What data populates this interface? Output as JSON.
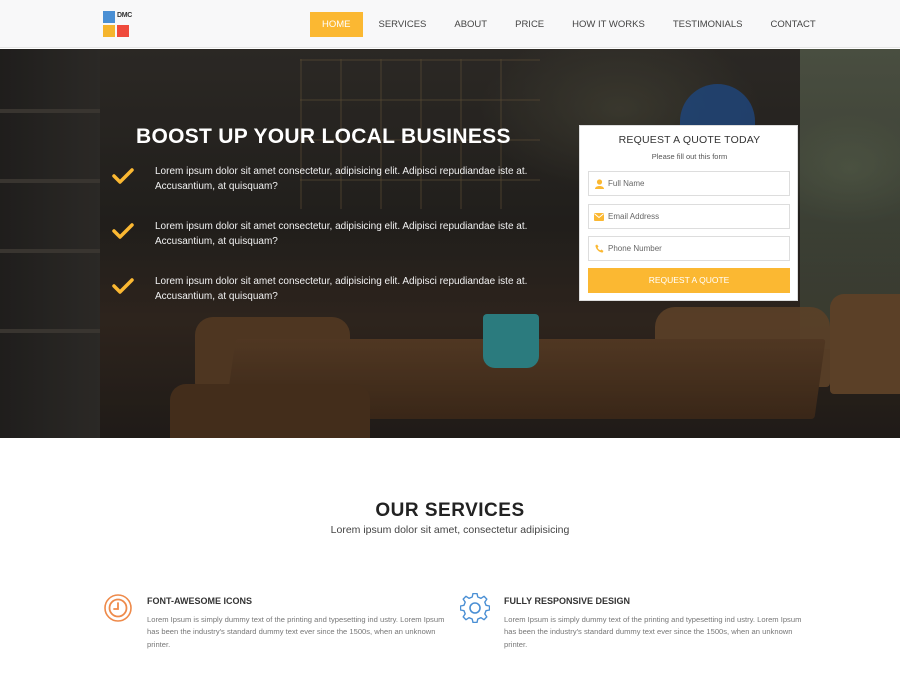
{
  "nav": {
    "logo_text": "DMC",
    "items": [
      {
        "label": "HOME",
        "active": true
      },
      {
        "label": "SERVICES",
        "active": false
      },
      {
        "label": "ABOUT",
        "active": false
      },
      {
        "label": "PRICE",
        "active": false
      },
      {
        "label": "HOW IT WORKS",
        "active": false
      },
      {
        "label": "TESTIMONIALS",
        "active": false
      },
      {
        "label": "CONTACT",
        "active": false
      }
    ]
  },
  "hero": {
    "title": "BOOST UP YOUR LOCAL BUSINESS",
    "features": [
      "Lorem ipsum dolor sit amet consectetur, adipisicing elit. Adipisci repudiandae iste at. Accusantium, at quisquam?",
      "Lorem ipsum dolor sit amet consectetur, adipisicing elit. Adipisci repudiandae iste at. Accusantium, at quisquam?",
      "Lorem ipsum dolor sit amet consectetur, adipisicing elit. Adipisci repudiandae iste at. Accusantium, at quisquam?"
    ]
  },
  "quote_form": {
    "title": "REQUEST A QUOTE TODAY",
    "subtitle": "Please fill out this form",
    "name_placeholder": "Full Name",
    "email_placeholder": "Email Address",
    "phone_placeholder": "Phone Number",
    "submit_label": "REQUEST A QUOTE"
  },
  "services": {
    "title": "OUR SERVICES",
    "subtitle": "Lorem ipsum dolor sit amet, consectetur adipisicing",
    "items": [
      {
        "icon": "clock-icon",
        "heading": "FONT-AWESOME ICONS",
        "text": "Lorem Ipsum is simply dummy text of the printing and typesetting ind ustry. Lorem Ipsum has been the industry's standard dummy text ever since the 1500s, when an unknown printer."
      },
      {
        "icon": "gear-icon",
        "heading": "FULLY RESPONSIVE DESIGN",
        "text": "Lorem Ipsum is simply dummy text of the printing and typesetting ind ustry. Lorem Ipsum has been the industry's standard dummy text ever since the 1500s, when an unknown printer."
      }
    ]
  },
  "colors": {
    "accent": "#fbb832",
    "service_clock_icon": "#ee8a4a",
    "service_gear_icon": "#4a8fd4"
  }
}
